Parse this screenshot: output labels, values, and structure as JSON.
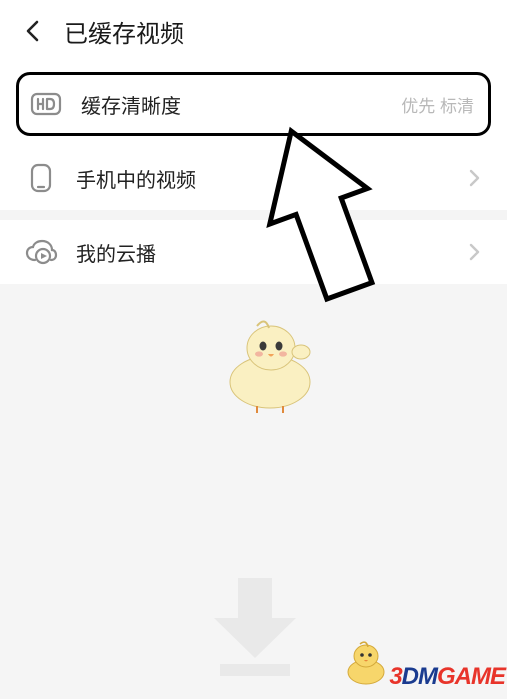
{
  "header": {
    "title": "已缓存视频"
  },
  "rows": {
    "quality": {
      "label": "缓存清晰度",
      "value": "优先 标清"
    },
    "phone": {
      "label": "手机中的视频"
    },
    "cloud": {
      "label": "我的云播"
    }
  },
  "watermark": {
    "p1": "3",
    "p2": "DM",
    "p3": "GAME"
  },
  "icons": {
    "hd": "hd-icon",
    "phone": "phone-icon",
    "cloud": "cloud-play-icon"
  }
}
